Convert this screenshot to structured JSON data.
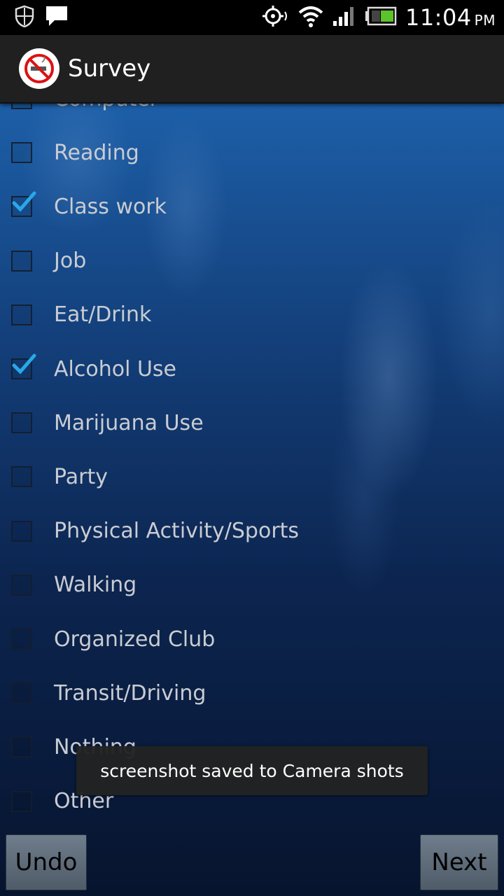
{
  "status_bar": {
    "time": "11:04",
    "ampm": "PM",
    "icons": [
      "shield-icon",
      "message-icon",
      "gps-icon",
      "wifi-icon",
      "signal-icon",
      "battery-icon"
    ]
  },
  "action_bar": {
    "title": "Survey",
    "icon": "no-smoking-icon"
  },
  "checklist": {
    "items": [
      {
        "label": "Computer",
        "checked": false
      },
      {
        "label": "Reading",
        "checked": false
      },
      {
        "label": "Class work",
        "checked": true
      },
      {
        "label": "Job",
        "checked": false
      },
      {
        "label": "Eat/Drink",
        "checked": false
      },
      {
        "label": "Alcohol Use",
        "checked": true
      },
      {
        "label": "Marijuana Use",
        "checked": false
      },
      {
        "label": "Party",
        "checked": false
      },
      {
        "label": "Physical Activity/Sports",
        "checked": false
      },
      {
        "label": "Walking",
        "checked": false
      },
      {
        "label": "Organized Club",
        "checked": false
      },
      {
        "label": "Transit/Driving",
        "checked": false
      },
      {
        "label": "Nothing",
        "checked": false
      },
      {
        "label": "Other",
        "checked": false
      }
    ]
  },
  "toast": {
    "message": "screenshot saved to Camera shots"
  },
  "buttons": {
    "undo": "Undo",
    "next": "Next"
  },
  "colors": {
    "accent_check": "#29a8e8",
    "action_bar": "#202020",
    "status_bar": "#000000"
  }
}
